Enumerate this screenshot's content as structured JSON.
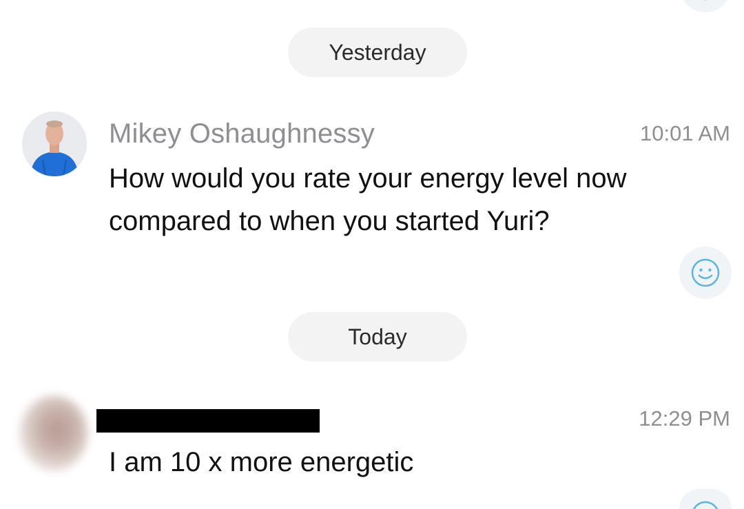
{
  "date_separators": {
    "yesterday": "Yesterday",
    "today": "Today"
  },
  "messages": [
    {
      "sender": "Mikey Oshaughnessy",
      "time": "10:01 AM",
      "text": "How would you rate your energy level now compared to when you started Yuri?"
    },
    {
      "sender": "",
      "sender_redacted": true,
      "time": "12:29 PM",
      "text": "I am 10 x more energetic"
    }
  ],
  "icons": {
    "react": "smiley-face-icon",
    "avatar_mikey": "avatar-photo",
    "avatar_user": "avatar-photo-blurred"
  },
  "colors": {
    "accent": "#5bb4e6",
    "pill_bg": "#f3f3f4",
    "meta_text": "#8e8e93",
    "avatar_shirt": "#1f6fd6"
  }
}
